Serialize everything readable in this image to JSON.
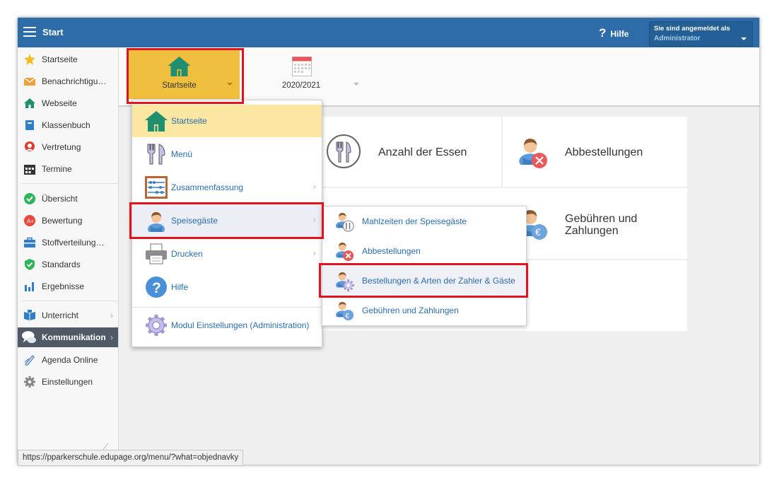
{
  "topbar": {
    "title": "Start",
    "help_label": "Hilfe",
    "user_line1": "Sie sind angemeldet als",
    "user_line2": "Administrator"
  },
  "sidebar": {
    "items": [
      {
        "label": "Startseite",
        "icon": "star-icon"
      },
      {
        "label": "Benachrichtigu…",
        "icon": "envelope-icon"
      },
      {
        "label": "Webseite",
        "icon": "home-icon"
      },
      {
        "label": "Klassenbuch",
        "icon": "book-icon"
      },
      {
        "label": "Vertretung",
        "icon": "person-icon"
      },
      {
        "label": "Termine",
        "icon": "calendar-icon"
      },
      {
        "label": "Übersicht",
        "icon": "check-icon"
      },
      {
        "label": "Bewertung",
        "icon": "grade-icon"
      },
      {
        "label": "Stoffverteilung…",
        "icon": "briefcase-icon"
      },
      {
        "label": "Standards",
        "icon": "shield-icon"
      },
      {
        "label": "Ergebnisse",
        "icon": "bar-chart-icon"
      },
      {
        "label": "Unterricht",
        "icon": "open-book-icon"
      },
      {
        "label": "Kommunikation",
        "icon": "chat-icon"
      },
      {
        "label": "Agenda Online",
        "icon": "pen-icon"
      },
      {
        "label": "Einstellungen",
        "icon": "gear-icon"
      }
    ]
  },
  "header": {
    "home_tile_label": "Startseite",
    "year_tile_label": "2020/2021"
  },
  "tiles": {
    "essen": "Anzahl der Essen",
    "abbestellungen": "Abbestellungen",
    "gebuehren_line1": "Gebühren und",
    "gebuehren_line2": "Zahlungen"
  },
  "menu": {
    "items": [
      {
        "label": "Startseite",
        "icon": "home-icon"
      },
      {
        "label": "Menü",
        "icon": "cutlery-icon"
      },
      {
        "label": "Zusammenfassung",
        "icon": "abacus-icon"
      },
      {
        "label": "Speisegäste",
        "icon": "person-icon"
      },
      {
        "label": "Drucken",
        "icon": "printer-icon"
      },
      {
        "label": "Hilfe",
        "icon": "help-icon"
      },
      {
        "label": "Modul Einstellungen (Administration)",
        "icon": "gear-icon"
      }
    ]
  },
  "submenu": {
    "items": [
      {
        "label": "Mahlzeiten der Speisegäste",
        "icon": "person-cutlery-icon"
      },
      {
        "label": "Abbestellungen",
        "icon": "person-cancel-icon"
      },
      {
        "label": "Bestellungen & Arten der Zahler & Gäste",
        "icon": "person-gear-icon"
      },
      {
        "label": "Gebühren und Zahlungen",
        "icon": "person-euro-icon"
      }
    ]
  },
  "status_url": "https://pparkerschule.edupage.org/menu/?what=objednavky",
  "colors": {
    "topbar": "#2d6ca8",
    "accent_yellow": "#f1bf3e",
    "highlight_red": "#e0141e",
    "link_blue": "#2a6db0"
  }
}
